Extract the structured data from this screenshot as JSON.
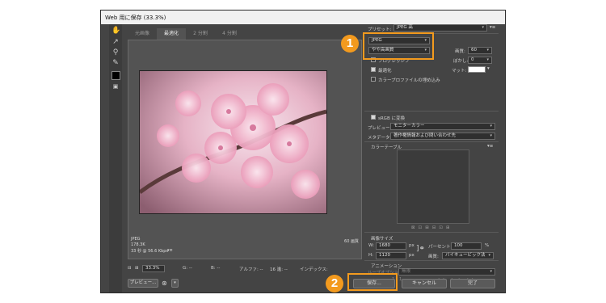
{
  "window": {
    "title": "Web 用に保存 (33.3%)"
  },
  "tabs": [
    "元画像",
    "最適化",
    "2 分割",
    "4 分割"
  ],
  "preview": {
    "format": "JPEG",
    "filesize": "178.3K",
    "time": "33 秒 @ 56.6 Kbps",
    "quality": "60 画質"
  },
  "bottom_toolbar": {
    "zoom": "33.3%",
    "g": "G: --",
    "b": "B: --",
    "alpha": "アルファ: --",
    "hex": "16 進: --",
    "index": "インデックス:"
  },
  "buttons": {
    "preview": "プレビュー...",
    "save": "保存...",
    "cancel": "キャンセル",
    "done": "完了"
  },
  "settings": {
    "preset_label": "プリセット:",
    "preset_value": "JPEG 高",
    "format": "JPEG",
    "quality_preset": "やや高画質",
    "quality_label": "画質:",
    "quality_value": "60",
    "progressive": "プログレッシブ",
    "blur_label": "ぼかし:",
    "blur_value": "0",
    "optimized": "最適化",
    "matte_label": "マット:",
    "embed_profile": "カラープロファイルの埋め込み",
    "srgb": "sRGB に変換",
    "preview_label": "プレビュー:",
    "preview_value": "モニターカラー",
    "metadata_label": "メタデータ:",
    "metadata_value": "著作権情報および問い合わせ先",
    "color_table": "カラーテーブル",
    "image_size": "画像サイズ",
    "w_label": "W:",
    "w_value": "1680",
    "h_label": "H:",
    "h_value": "1120",
    "px": "px",
    "percent_label": "パーセント:",
    "percent_value": "100",
    "percent_unit": "%",
    "resample_label": "画質:",
    "resample_value": "バイキュービック法",
    "animation": "アニメーション",
    "loop_label": "ループオプション:",
    "loop_value": "無限",
    "frame": "1 / 1"
  },
  "callouts": [
    "1",
    "2"
  ],
  "colors": {
    "accent": "#f39a1e",
    "dialog": "#444444"
  }
}
